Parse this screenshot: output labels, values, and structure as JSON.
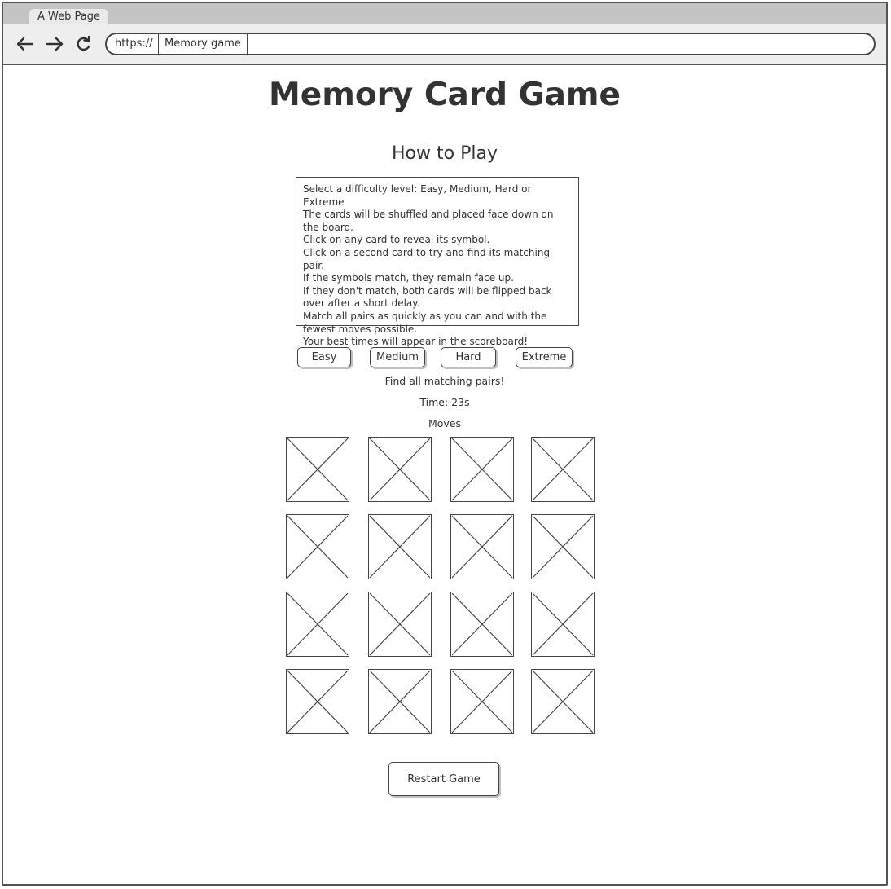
{
  "browser": {
    "tab_label": "A Web Page",
    "url_scheme": "https://",
    "url_page": "Memory game",
    "icons": [
      "back-arrow-icon",
      "forward-arrow-icon",
      "reload-icon"
    ]
  },
  "page": {
    "title": "Memory Card Game",
    "howto_heading": "How to Play",
    "instructions": [
      "Select a difficulty level: Easy, Medium, Hard or Extreme",
      "The cards will be shuffled and placed face down on the board.",
      "Click on any card to reveal its symbol.",
      "Click on a second card to try and find its matching pair.",
      "If the symbols match, they remain face up.",
      "If they don't match, both cards will be flipped back over after a short delay.",
      "Match all pairs as quickly as you can and with the fewest moves possible.",
      "Your best times will appear in the scoreboard!"
    ],
    "difficulty_buttons": [
      "Easy",
      "Medium",
      "Hard",
      "Extreme"
    ],
    "status_message": "Find all matching pairs!",
    "timer_text": "Time: 23s",
    "moves_label": "Moves",
    "card_grid": {
      "rows": 4,
      "cols": 4,
      "card_state": "face-down placeholder"
    },
    "restart_label": "Restart Game"
  }
}
